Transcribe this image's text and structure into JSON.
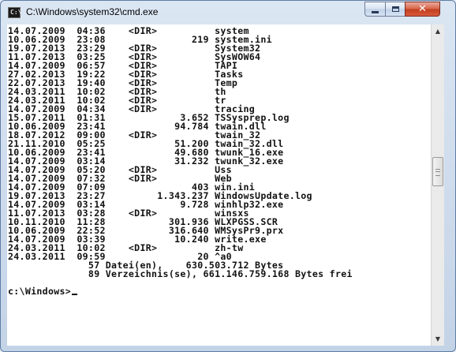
{
  "window": {
    "title": "C:\\Windows\\system32\\cmd.exe",
    "icon": "console-icon",
    "controls": {
      "minimize": "minimize-icon",
      "maximize": "maximize-icon",
      "close": "close-icon"
    },
    "close_color": "#c2401f"
  },
  "console": {
    "background": "#ffffff",
    "foreground": "#111111",
    "lines": [
      "14.07.2009  04:36    <DIR>          system",
      "10.06.2009  23:08               219 system.ini",
      "19.07.2013  23:29    <DIR>          System32",
      "11.07.2013  03:25    <DIR>          SysWOW64",
      "14.07.2009  06:57    <DIR>          TAPI",
      "27.02.2013  19:22    <DIR>          Tasks",
      "22.07.2013  19:40    <DIR>          Temp",
      "24.03.2011  10:02    <DIR>          th",
      "24.03.2011  10:02    <DIR>          tr",
      "14.07.2009  04:34    <DIR>          tracing",
      "15.07.2011  01:31             3.652 TSSysprep.log",
      "10.06.2009  23:41            94.784 twain.dll",
      "18.07.2012  09:00    <DIR>          twain_32",
      "21.11.2010  05:25            51.200 twain_32.dll",
      "10.06.2009  23:41            49.680 twunk_16.exe",
      "14.07.2009  03:14            31.232 twunk_32.exe",
      "14.07.2009  05:20    <DIR>          Uss",
      "14.07.2009  07:32    <DIR>          Web",
      "14.07.2009  07:09               403 win.ini",
      "19.07.2013  23:27         1.343.237 WindowsUpdate.log",
      "14.07.2009  03:14             9.728 winhlp32.exe",
      "11.07.2013  03:28    <DIR>          winsxs",
      "10.11.2010  11:28           301.936 WLXPGSS.SCR",
      "10.06.2009  22:52           316.640 WMSysPr9.prx",
      "14.07.2009  03:39            10.240 write.exe",
      "24.03.2011  10:02    <DIR>          zh-tw",
      "24.03.2011  09:59                20 ^a0",
      "              57 Datei(en),    630.503.712 Bytes",
      "              89 Verzeichnis(se), 661.146.759.168 Bytes frei",
      "",
      "c:\\Windows>"
    ]
  },
  "scrollbar": {
    "up_icon": "scroll-up-arrow-icon",
    "down_icon": "scroll-down-arrow-icon",
    "position": 0.45
  }
}
